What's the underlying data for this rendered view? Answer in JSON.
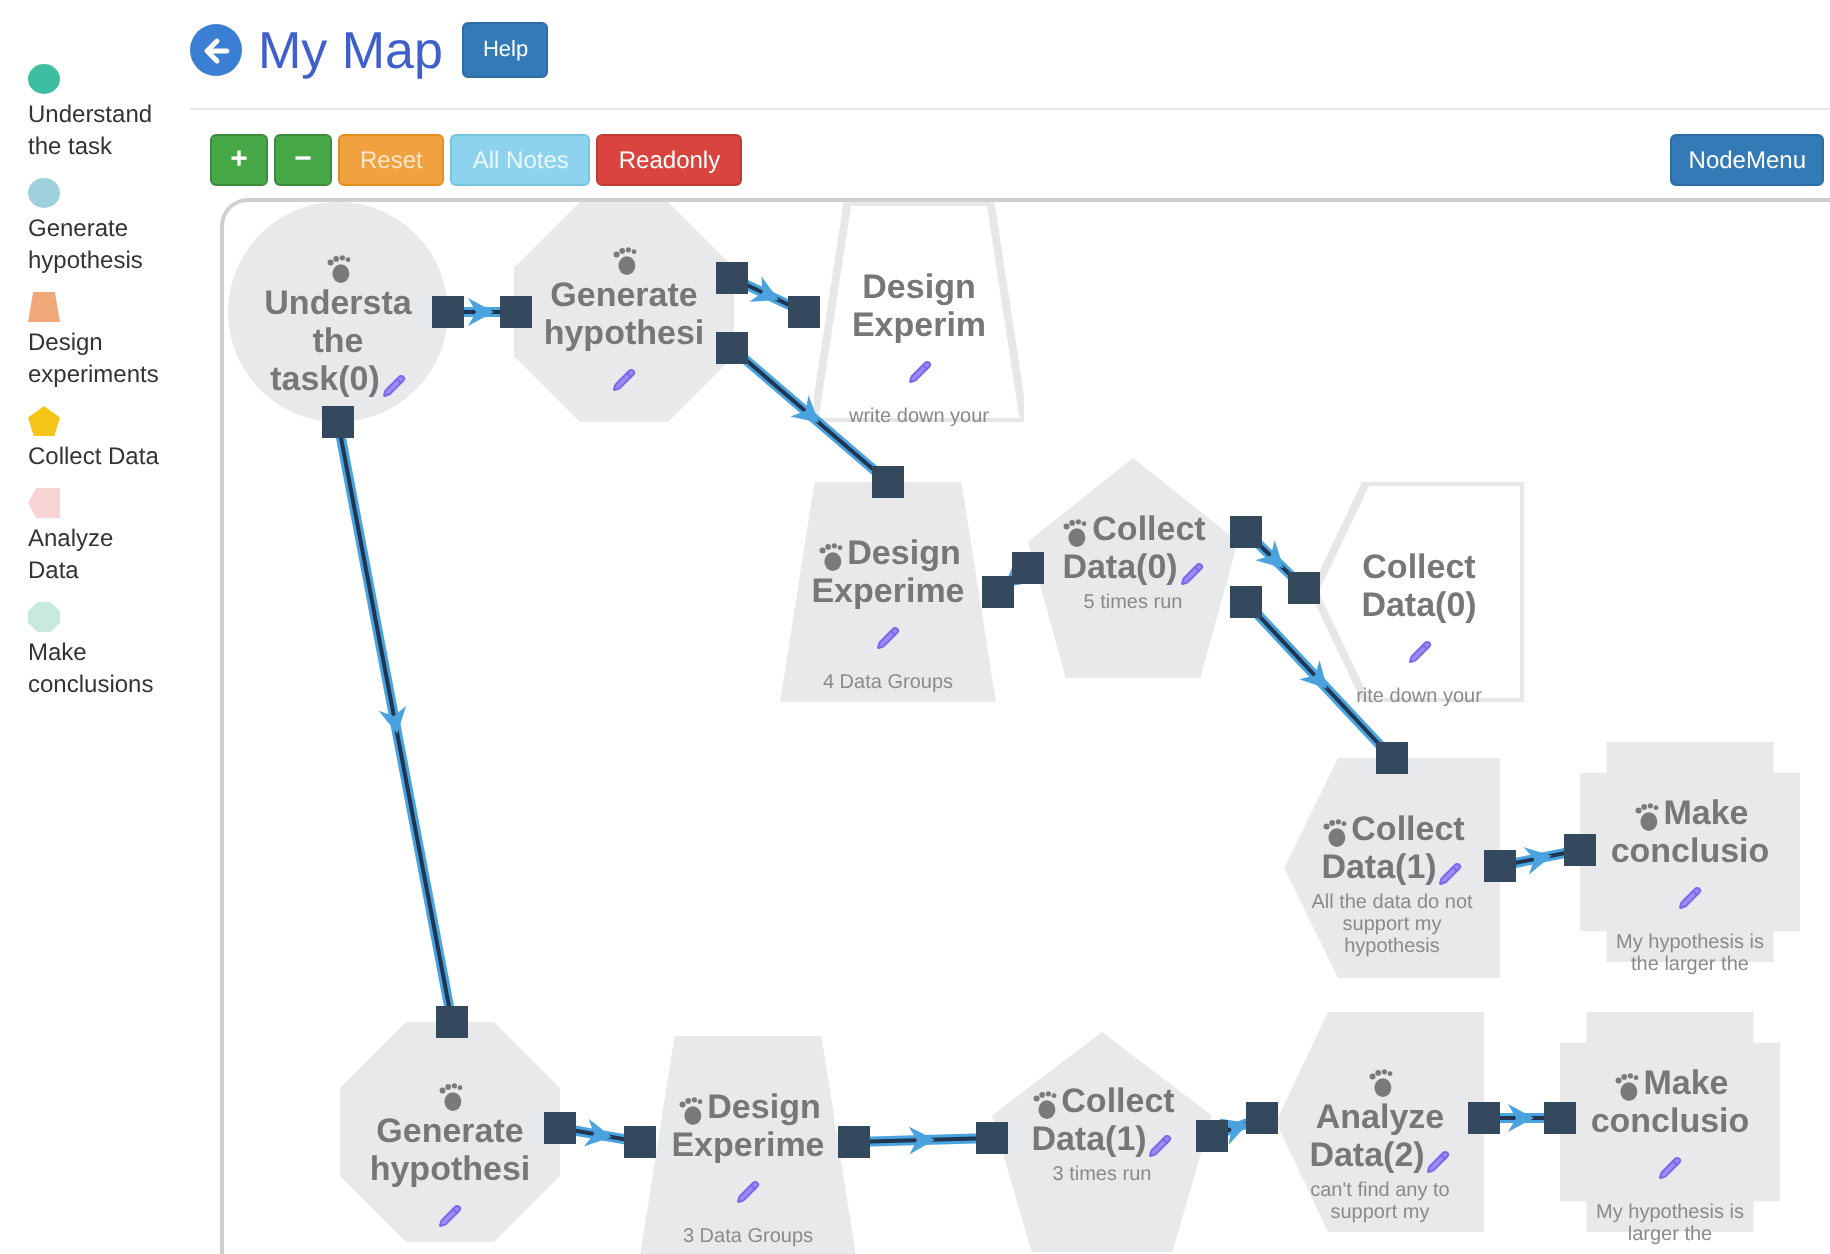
{
  "legend": [
    {
      "label": "Understand the task",
      "kind": "circle",
      "color": "#3dbea0"
    },
    {
      "label": "Generate hypothesis",
      "kind": "circle",
      "color": "#9dd0dc"
    },
    {
      "label": "Design experiments",
      "kind": "trapezoid",
      "color": "#f0a77a"
    },
    {
      "label": "Collect Data",
      "kind": "pentagon",
      "color": "#f5c518"
    },
    {
      "label": "Analyze Data",
      "kind": "arrow",
      "color": "#f7d4d4"
    },
    {
      "label": "Make conclusions",
      "kind": "octagon",
      "color": "#c8e9de"
    }
  ],
  "header": {
    "title": "My Map",
    "help_button": "Help"
  },
  "toolbar": {
    "buttons": [
      {
        "label": "+",
        "kind": "green"
      },
      {
        "label": "−",
        "kind": "green"
      },
      {
        "label": "Reset",
        "kind": "orange"
      },
      {
        "label": "All Notes",
        "kind": "info"
      },
      {
        "label": "Readonly",
        "kind": "red"
      }
    ],
    "node_menu": "NodeMenu"
  },
  "nodes": [
    {
      "kind": "circle",
      "filled": true,
      "title_lines": [
        "Understa",
        "the",
        "task(0)"
      ]
    },
    {
      "kind": "octagon",
      "filled": true,
      "title_lines": [
        "Generate",
        "hypothesi"
      ]
    },
    {
      "kind": "trapezoid",
      "filled": false,
      "title_lines": [
        "Design",
        "Experim"
      ],
      "note_lines": [
        "write down your"
      ]
    },
    {
      "kind": "trapezoid",
      "filled": true,
      "title_lines": [
        "Design",
        "Experime"
      ],
      "note_lines": [
        "4 Data Groups"
      ]
    },
    {
      "kind": "pentagon",
      "filled": true,
      "title_lines": [
        "Collect",
        "Data(0)"
      ],
      "note_lines": [
        "5 times run"
      ]
    },
    {
      "kind": "arrow",
      "filled": false,
      "title_lines": [
        "Collect",
        "Data(0)"
      ],
      "note_lines": [
        "rite down your"
      ]
    },
    {
      "kind": "arrow",
      "filled": true,
      "title_lines": [
        "Collect",
        "Data(1)"
      ],
      "note_lines": [
        "All the data do not",
        "support my",
        "hypothesis"
      ]
    },
    {
      "kind": "cross",
      "filled": true,
      "title_lines": [
        "Make",
        "conclusio"
      ],
      "note_lines": [
        "My hypothesis is",
        "the larger the"
      ]
    },
    {
      "kind": "octagon",
      "filled": true,
      "title_lines": [
        "Generate",
        "hypothesi"
      ]
    },
    {
      "kind": "trapezoid",
      "filled": true,
      "title_lines": [
        "Design",
        "Experime"
      ],
      "note_lines": [
        "3 Data Groups"
      ]
    },
    {
      "kind": "pentagon",
      "filled": true,
      "title_lines": [
        "Collect",
        "Data(1)"
      ],
      "note_lines": [
        "3 times run"
      ]
    },
    {
      "kind": "arrow",
      "filled": true,
      "title_lines": [
        "Analyze",
        "Data(2)"
      ],
      "note_lines": [
        "can't find any to",
        "support my"
      ]
    },
    {
      "kind": "cross",
      "filled": true,
      "title_lines": [
        "Make",
        "conclusio"
      ],
      "note_lines": [
        "My hypothesis is",
        "larger the"
      ]
    }
  ]
}
